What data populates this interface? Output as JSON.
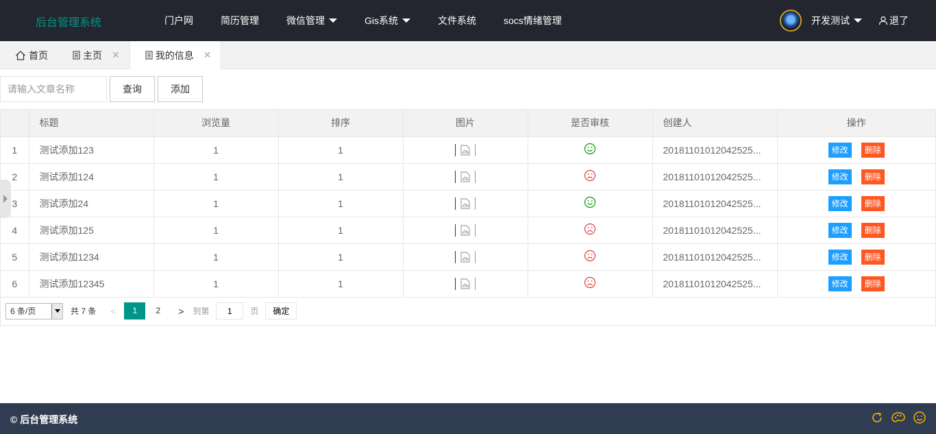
{
  "app": {
    "logo": "后台管理系统"
  },
  "topnav": {
    "items": [
      {
        "label": "门户网",
        "has_dropdown": false
      },
      {
        "label": "简历管理",
        "has_dropdown": false
      },
      {
        "label": "微信管理",
        "has_dropdown": true
      },
      {
        "label": "Gis系统",
        "has_dropdown": true
      },
      {
        "label": "文件系统",
        "has_dropdown": false
      },
      {
        "label": "socs情绪管理",
        "has_dropdown": false
      }
    ]
  },
  "user": {
    "name": "开发测试",
    "logout": "退了"
  },
  "tabs": [
    {
      "label": "首页",
      "closable": false,
      "active": false
    },
    {
      "label": "主页",
      "closable": true,
      "active": false
    },
    {
      "label": "我的信息",
      "closable": true,
      "active": true
    }
  ],
  "toolbar": {
    "search_placeholder": "请输入文章名称",
    "search_value": "",
    "query_label": "查询",
    "add_label": "添加"
  },
  "table": {
    "headers": [
      "",
      "标题",
      "浏览量",
      "排序",
      "图片",
      "是否审核",
      "创建人",
      "操作"
    ],
    "rows": [
      {
        "index": "1",
        "title": "测试添加123",
        "views": "1",
        "sort": "1",
        "approved": true,
        "creator": "20181101012042525..."
      },
      {
        "index": "2",
        "title": "测试添加124",
        "views": "1",
        "sort": "1",
        "approved": false,
        "creator": "20181101012042525..."
      },
      {
        "index": "3",
        "title": "测试添加24",
        "views": "1",
        "sort": "1",
        "approved": true,
        "creator": "20181101012042525..."
      },
      {
        "index": "4",
        "title": "测试添加125",
        "views": "1",
        "sort": "1",
        "approved": false,
        "creator": "20181101012042525..."
      },
      {
        "index": "5",
        "title": "测试添加1234",
        "views": "1",
        "sort": "1",
        "approved": false,
        "creator": "20181101012042525..."
      },
      {
        "index": "6",
        "title": "测试添加12345",
        "views": "1",
        "sort": "1",
        "approved": false,
        "creator": "20181101012042525..."
      }
    ],
    "edit_label": "修改",
    "delete_label": "删除"
  },
  "pagination": {
    "page_size": "6 条/页",
    "total": "共 7 条",
    "pages": [
      "1",
      "2"
    ],
    "current": "1",
    "goto_label": "到第",
    "goto_value": "1",
    "page_unit": "页",
    "confirm": "确定"
  },
  "footer": {
    "copyright": "© 后台管理系统"
  },
  "colors": {
    "header_bg": "#23262e",
    "logo": "#009688",
    "primary": "#009688",
    "edit": "#1E9FFF",
    "delete": "#FF5722",
    "approved": "#009900",
    "rejected": "#e23b3b",
    "footer_bg": "#2f3c51",
    "footer_icon": "#f7b500"
  }
}
